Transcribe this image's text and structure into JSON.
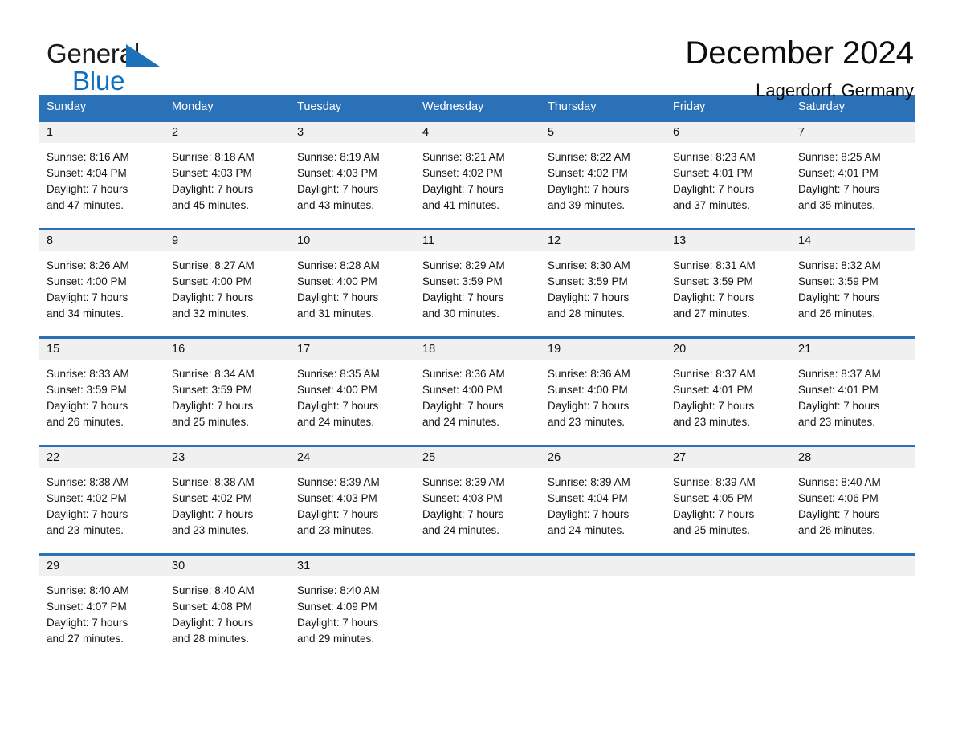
{
  "brand": {
    "name_part1": "General",
    "name_part2": "Blue",
    "accent_color": "#1d71b8",
    "blue_text_color": "#0b6fc4"
  },
  "header": {
    "month_title": "December 2024",
    "location": "Lagerdorf, Germany"
  },
  "calendar": {
    "header_bg": "#2b71b8",
    "datebar_bg": "#f0f0f0",
    "weekdays": [
      "Sunday",
      "Monday",
      "Tuesday",
      "Wednesday",
      "Thursday",
      "Friday",
      "Saturday"
    ],
    "weeks": [
      [
        {
          "date": "1",
          "sunrise": "Sunrise: 8:16 AM",
          "sunset": "Sunset: 4:04 PM",
          "daylight_line1": "Daylight: 7 hours",
          "daylight_line2": "and 47 minutes."
        },
        {
          "date": "2",
          "sunrise": "Sunrise: 8:18 AM",
          "sunset": "Sunset: 4:03 PM",
          "daylight_line1": "Daylight: 7 hours",
          "daylight_line2": "and 45 minutes."
        },
        {
          "date": "3",
          "sunrise": "Sunrise: 8:19 AM",
          "sunset": "Sunset: 4:03 PM",
          "daylight_line1": "Daylight: 7 hours",
          "daylight_line2": "and 43 minutes."
        },
        {
          "date": "4",
          "sunrise": "Sunrise: 8:21 AM",
          "sunset": "Sunset: 4:02 PM",
          "daylight_line1": "Daylight: 7 hours",
          "daylight_line2": "and 41 minutes."
        },
        {
          "date": "5",
          "sunrise": "Sunrise: 8:22 AM",
          "sunset": "Sunset: 4:02 PM",
          "daylight_line1": "Daylight: 7 hours",
          "daylight_line2": "and 39 minutes."
        },
        {
          "date": "6",
          "sunrise": "Sunrise: 8:23 AM",
          "sunset": "Sunset: 4:01 PM",
          "daylight_line1": "Daylight: 7 hours",
          "daylight_line2": "and 37 minutes."
        },
        {
          "date": "7",
          "sunrise": "Sunrise: 8:25 AM",
          "sunset": "Sunset: 4:01 PM",
          "daylight_line1": "Daylight: 7 hours",
          "daylight_line2": "and 35 minutes."
        }
      ],
      [
        {
          "date": "8",
          "sunrise": "Sunrise: 8:26 AM",
          "sunset": "Sunset: 4:00 PM",
          "daylight_line1": "Daylight: 7 hours",
          "daylight_line2": "and 34 minutes."
        },
        {
          "date": "9",
          "sunrise": "Sunrise: 8:27 AM",
          "sunset": "Sunset: 4:00 PM",
          "daylight_line1": "Daylight: 7 hours",
          "daylight_line2": "and 32 minutes."
        },
        {
          "date": "10",
          "sunrise": "Sunrise: 8:28 AM",
          "sunset": "Sunset: 4:00 PM",
          "daylight_line1": "Daylight: 7 hours",
          "daylight_line2": "and 31 minutes."
        },
        {
          "date": "11",
          "sunrise": "Sunrise: 8:29 AM",
          "sunset": "Sunset: 3:59 PM",
          "daylight_line1": "Daylight: 7 hours",
          "daylight_line2": "and 30 minutes."
        },
        {
          "date": "12",
          "sunrise": "Sunrise: 8:30 AM",
          "sunset": "Sunset: 3:59 PM",
          "daylight_line1": "Daylight: 7 hours",
          "daylight_line2": "and 28 minutes."
        },
        {
          "date": "13",
          "sunrise": "Sunrise: 8:31 AM",
          "sunset": "Sunset: 3:59 PM",
          "daylight_line1": "Daylight: 7 hours",
          "daylight_line2": "and 27 minutes."
        },
        {
          "date": "14",
          "sunrise": "Sunrise: 8:32 AM",
          "sunset": "Sunset: 3:59 PM",
          "daylight_line1": "Daylight: 7 hours",
          "daylight_line2": "and 26 minutes."
        }
      ],
      [
        {
          "date": "15",
          "sunrise": "Sunrise: 8:33 AM",
          "sunset": "Sunset: 3:59 PM",
          "daylight_line1": "Daylight: 7 hours",
          "daylight_line2": "and 26 minutes."
        },
        {
          "date": "16",
          "sunrise": "Sunrise: 8:34 AM",
          "sunset": "Sunset: 3:59 PM",
          "daylight_line1": "Daylight: 7 hours",
          "daylight_line2": "and 25 minutes."
        },
        {
          "date": "17",
          "sunrise": "Sunrise: 8:35 AM",
          "sunset": "Sunset: 4:00 PM",
          "daylight_line1": "Daylight: 7 hours",
          "daylight_line2": "and 24 minutes."
        },
        {
          "date": "18",
          "sunrise": "Sunrise: 8:36 AM",
          "sunset": "Sunset: 4:00 PM",
          "daylight_line1": "Daylight: 7 hours",
          "daylight_line2": "and 24 minutes."
        },
        {
          "date": "19",
          "sunrise": "Sunrise: 8:36 AM",
          "sunset": "Sunset: 4:00 PM",
          "daylight_line1": "Daylight: 7 hours",
          "daylight_line2": "and 23 minutes."
        },
        {
          "date": "20",
          "sunrise": "Sunrise: 8:37 AM",
          "sunset": "Sunset: 4:01 PM",
          "daylight_line1": "Daylight: 7 hours",
          "daylight_line2": "and 23 minutes."
        },
        {
          "date": "21",
          "sunrise": "Sunrise: 8:37 AM",
          "sunset": "Sunset: 4:01 PM",
          "daylight_line1": "Daylight: 7 hours",
          "daylight_line2": "and 23 minutes."
        }
      ],
      [
        {
          "date": "22",
          "sunrise": "Sunrise: 8:38 AM",
          "sunset": "Sunset: 4:02 PM",
          "daylight_line1": "Daylight: 7 hours",
          "daylight_line2": "and 23 minutes."
        },
        {
          "date": "23",
          "sunrise": "Sunrise: 8:38 AM",
          "sunset": "Sunset: 4:02 PM",
          "daylight_line1": "Daylight: 7 hours",
          "daylight_line2": "and 23 minutes."
        },
        {
          "date": "24",
          "sunrise": "Sunrise: 8:39 AM",
          "sunset": "Sunset: 4:03 PM",
          "daylight_line1": "Daylight: 7 hours",
          "daylight_line2": "and 23 minutes."
        },
        {
          "date": "25",
          "sunrise": "Sunrise: 8:39 AM",
          "sunset": "Sunset: 4:03 PM",
          "daylight_line1": "Daylight: 7 hours",
          "daylight_line2": "and 24 minutes."
        },
        {
          "date": "26",
          "sunrise": "Sunrise: 8:39 AM",
          "sunset": "Sunset: 4:04 PM",
          "daylight_line1": "Daylight: 7 hours",
          "daylight_line2": "and 24 minutes."
        },
        {
          "date": "27",
          "sunrise": "Sunrise: 8:39 AM",
          "sunset": "Sunset: 4:05 PM",
          "daylight_line1": "Daylight: 7 hours",
          "daylight_line2": "and 25 minutes."
        },
        {
          "date": "28",
          "sunrise": "Sunrise: 8:40 AM",
          "sunset": "Sunset: 4:06 PM",
          "daylight_line1": "Daylight: 7 hours",
          "daylight_line2": "and 26 minutes."
        }
      ],
      [
        {
          "date": "29",
          "sunrise": "Sunrise: 8:40 AM",
          "sunset": "Sunset: 4:07 PM",
          "daylight_line1": "Daylight: 7 hours",
          "daylight_line2": "and 27 minutes."
        },
        {
          "date": "30",
          "sunrise": "Sunrise: 8:40 AM",
          "sunset": "Sunset: 4:08 PM",
          "daylight_line1": "Daylight: 7 hours",
          "daylight_line2": "and 28 minutes."
        },
        {
          "date": "31",
          "sunrise": "Sunrise: 8:40 AM",
          "sunset": "Sunset: 4:09 PM",
          "daylight_line1": "Daylight: 7 hours",
          "daylight_line2": "and 29 minutes."
        },
        {
          "date": "",
          "sunrise": "",
          "sunset": "",
          "daylight_line1": "",
          "daylight_line2": ""
        },
        {
          "date": "",
          "sunrise": "",
          "sunset": "",
          "daylight_line1": "",
          "daylight_line2": ""
        },
        {
          "date": "",
          "sunrise": "",
          "sunset": "",
          "daylight_line1": "",
          "daylight_line2": ""
        },
        {
          "date": "",
          "sunrise": "",
          "sunset": "",
          "daylight_line1": "",
          "daylight_line2": ""
        }
      ]
    ]
  }
}
